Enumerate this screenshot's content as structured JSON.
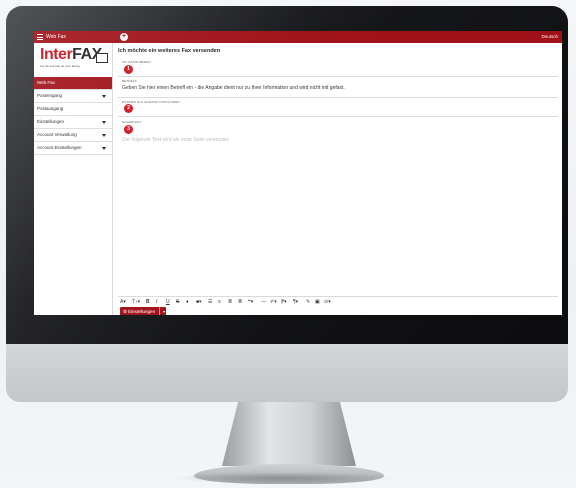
{
  "app": {
    "title": "Web Fax",
    "new_icon": "plus-circle-icon",
    "language": "Deutsch"
  },
  "logo": {
    "part1": "Inter",
    "part2": "FAX",
    "tagline": "Let the internet do your faxing"
  },
  "sidebar": {
    "items": [
      {
        "label": "Web Fax",
        "active": true,
        "has_caret": false
      },
      {
        "label": "Posteingang",
        "active": false,
        "has_caret": true
      },
      {
        "label": "Postausgang",
        "active": false,
        "has_caret": false
      },
      {
        "label": "Einstellungen",
        "active": false,
        "has_caret": true
      },
      {
        "label": "Account Verwaltung",
        "active": false,
        "has_caret": true
      },
      {
        "label": "Account Einstellungen",
        "active": false,
        "has_caret": true
      }
    ]
  },
  "main": {
    "heading": "Ich möchte ein weiteres Fax versenden",
    "fields": [
      {
        "label": "AN (FAXNUMMER)",
        "step": "1",
        "value": ""
      },
      {
        "label": "BETREFF",
        "value": "Geben Sie hier einen Betreff ein - die Angabe dient nur zu Ihrer Information und wird nicht mit gefaxt."
      },
      {
        "label": "DATEIEN ALS ANHANG HOCHLADEN",
        "step": "2"
      },
      {
        "label": "NACHRICHT",
        "step": "3",
        "placeholder": "Der folgende Text wird als erste Seite versendet."
      }
    ],
    "toolbar": [
      "A▾",
      "T↕▾",
      "B",
      "I",
      "U",
      "S",
      "♦",
      "■▾",
      "☰",
      "≡",
      "≣",
      "≣",
      "❝▾",
      "—",
      "✐▾",
      "⁋▾",
      "¶▾",
      "✎",
      "▣",
      "⊙▾"
    ],
    "settings_button": "Einstellungen"
  },
  "colors": {
    "brand_red": "#a01018",
    "step_red": "#d0161f"
  }
}
